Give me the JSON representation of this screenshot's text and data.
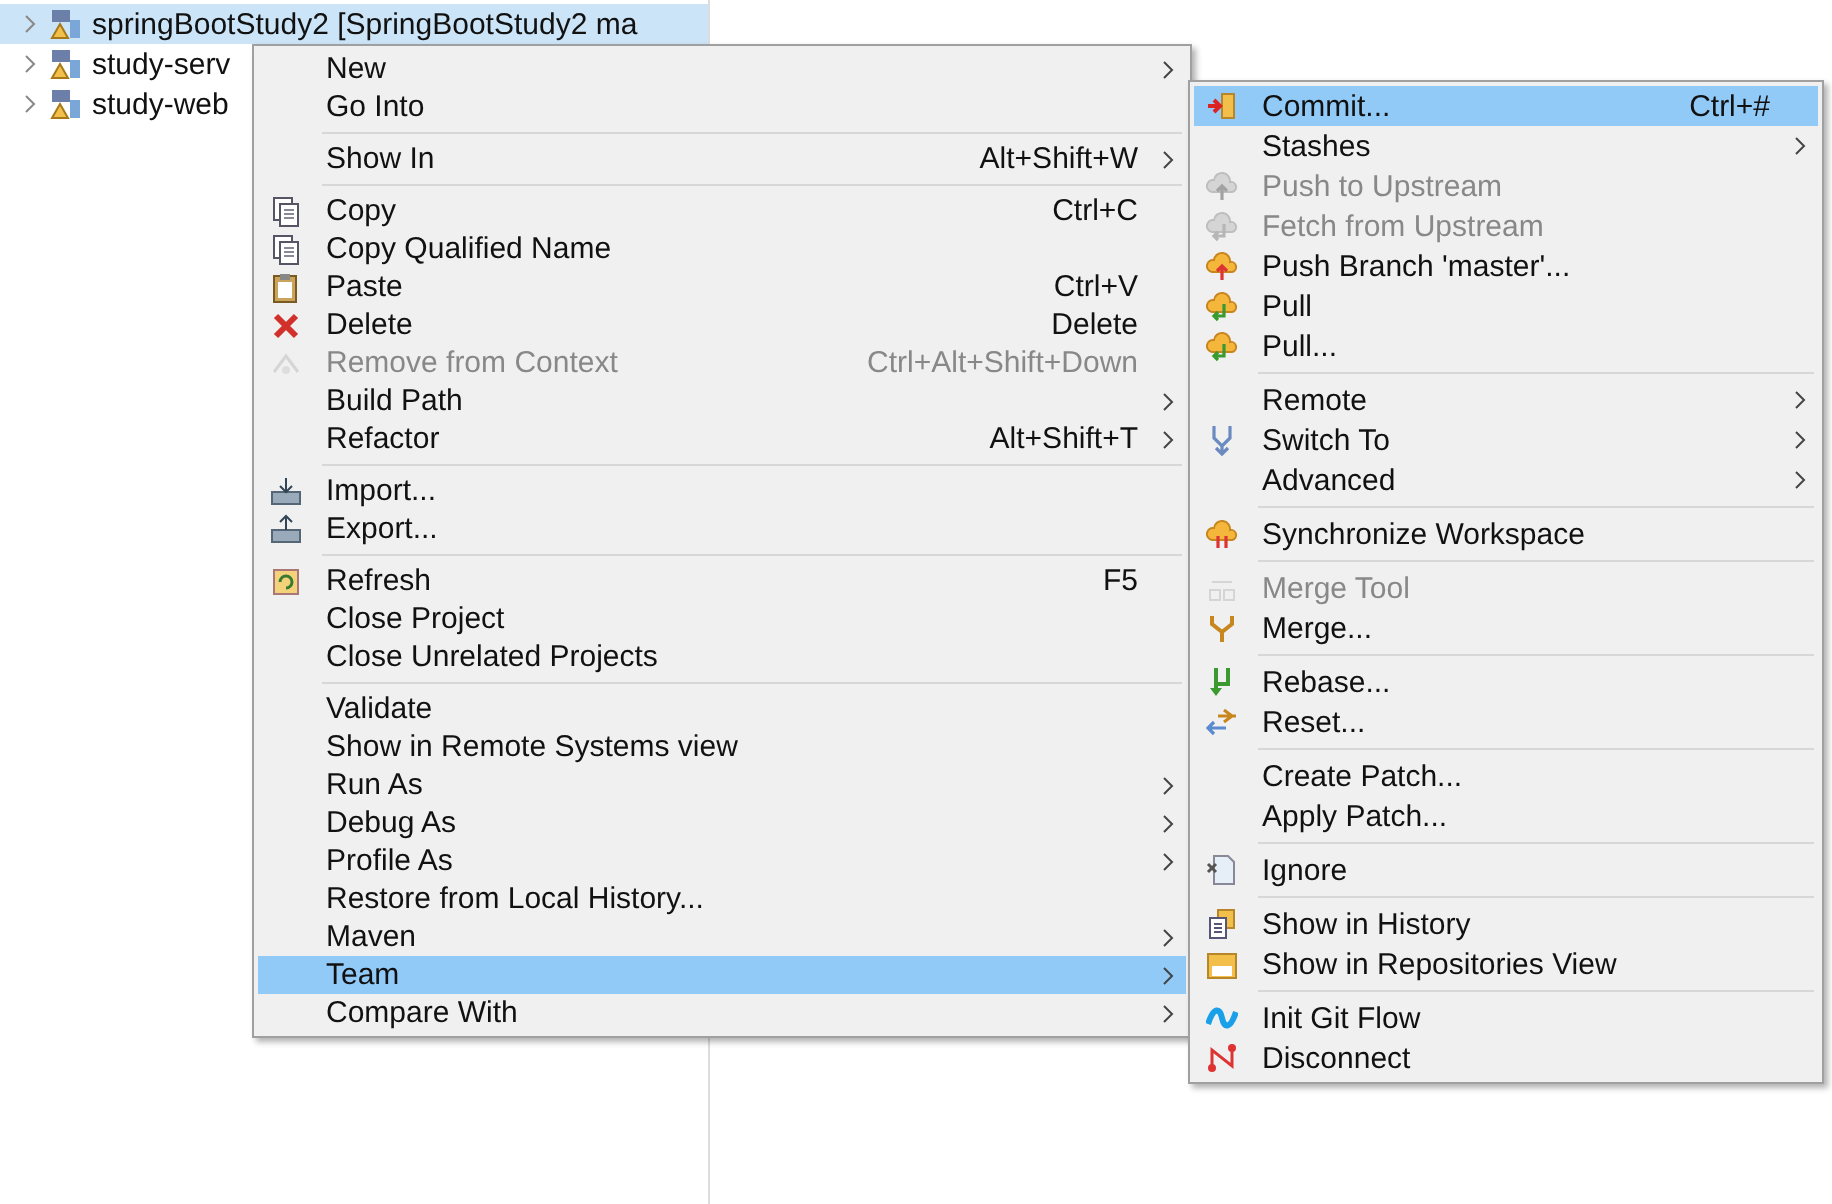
{
  "tree": {
    "items": [
      {
        "label": "springBootStudy2 [SpringBootStudy2 ma",
        "selected": true,
        "expanded": false
      },
      {
        "label": "study-serv",
        "selected": false,
        "expanded": false
      },
      {
        "label": "study-web",
        "selected": false,
        "expanded": false
      }
    ]
  },
  "context_menu": {
    "items": [
      {
        "kind": "item",
        "label": "New",
        "submenu": true,
        "selected": false,
        "disabled": false
      },
      {
        "kind": "item",
        "label": "Go Into",
        "selected": false,
        "disabled": false
      },
      {
        "kind": "separator"
      },
      {
        "kind": "item",
        "label": "Show In",
        "shortcut": "Alt+Shift+W",
        "submenu": true,
        "selected": false,
        "disabled": false
      },
      {
        "kind": "separator"
      },
      {
        "kind": "item",
        "label": "Copy",
        "shortcut": "Ctrl+C",
        "selected": false,
        "disabled": false
      },
      {
        "kind": "item",
        "label": "Copy Qualified Name",
        "selected": false,
        "disabled": false
      },
      {
        "kind": "item",
        "label": "Paste",
        "shortcut": "Ctrl+V",
        "selected": false,
        "disabled": false
      },
      {
        "kind": "item",
        "label": "Delete",
        "shortcut": "Delete",
        "selected": false,
        "disabled": false
      },
      {
        "kind": "item",
        "label": "Remove from Context",
        "shortcut": "Ctrl+Alt+Shift+Down",
        "selected": false,
        "disabled": true
      },
      {
        "kind": "item",
        "label": "Build Path",
        "submenu": true,
        "selected": false,
        "disabled": false
      },
      {
        "kind": "item",
        "label": "Refactor",
        "shortcut": "Alt+Shift+T",
        "submenu": true,
        "selected": false,
        "disabled": false
      },
      {
        "kind": "separator"
      },
      {
        "kind": "item",
        "label": "Import...",
        "selected": false,
        "disabled": false
      },
      {
        "kind": "item",
        "label": "Export...",
        "selected": false,
        "disabled": false
      },
      {
        "kind": "separator"
      },
      {
        "kind": "item",
        "label": "Refresh",
        "shortcut": "F5",
        "selected": false,
        "disabled": false
      },
      {
        "kind": "item",
        "label": "Close Project",
        "selected": false,
        "disabled": false
      },
      {
        "kind": "item",
        "label": "Close Unrelated Projects",
        "selected": false,
        "disabled": false
      },
      {
        "kind": "separator"
      },
      {
        "kind": "item",
        "label": "Validate",
        "selected": false,
        "disabled": false
      },
      {
        "kind": "item",
        "label": "Show in Remote Systems view",
        "selected": false,
        "disabled": false
      },
      {
        "kind": "item",
        "label": "Run As",
        "submenu": true,
        "selected": false,
        "disabled": false
      },
      {
        "kind": "item",
        "label": "Debug As",
        "submenu": true,
        "selected": false,
        "disabled": false
      },
      {
        "kind": "item",
        "label": "Profile As",
        "submenu": true,
        "selected": false,
        "disabled": false
      },
      {
        "kind": "item",
        "label": "Restore from Local History...",
        "selected": false,
        "disabled": false
      },
      {
        "kind": "item",
        "label": "Maven",
        "submenu": true,
        "selected": false,
        "disabled": false
      },
      {
        "kind": "item",
        "label": "Team",
        "submenu": true,
        "selected": true,
        "disabled": false
      },
      {
        "kind": "item",
        "label": "Compare With",
        "submenu": true,
        "selected": false,
        "disabled": false
      }
    ]
  },
  "team_menu": {
    "items": [
      {
        "kind": "item",
        "label": "Commit...",
        "shortcut": "Ctrl+#",
        "selected": true,
        "disabled": false
      },
      {
        "kind": "item",
        "label": "Stashes",
        "submenu": true,
        "selected": false,
        "disabled": false
      },
      {
        "kind": "item",
        "label": "Push to Upstream",
        "selected": false,
        "disabled": true
      },
      {
        "kind": "item",
        "label": "Fetch from Upstream",
        "selected": false,
        "disabled": true
      },
      {
        "kind": "item",
        "label": "Push Branch 'master'...",
        "selected": false,
        "disabled": false
      },
      {
        "kind": "item",
        "label": "Pull",
        "selected": false,
        "disabled": false
      },
      {
        "kind": "item",
        "label": "Pull...",
        "selected": false,
        "disabled": false
      },
      {
        "kind": "separator"
      },
      {
        "kind": "item",
        "label": "Remote",
        "submenu": true,
        "selected": false,
        "disabled": false
      },
      {
        "kind": "item",
        "label": "Switch To",
        "submenu": true,
        "selected": false,
        "disabled": false
      },
      {
        "kind": "item",
        "label": "Advanced",
        "submenu": true,
        "selected": false,
        "disabled": false
      },
      {
        "kind": "separator"
      },
      {
        "kind": "item",
        "label": "Synchronize Workspace",
        "selected": false,
        "disabled": false
      },
      {
        "kind": "separator"
      },
      {
        "kind": "item",
        "label": "Merge Tool",
        "selected": false,
        "disabled": true
      },
      {
        "kind": "item",
        "label": "Merge...",
        "selected": false,
        "disabled": false
      },
      {
        "kind": "separator"
      },
      {
        "kind": "item",
        "label": "Rebase...",
        "selected": false,
        "disabled": false
      },
      {
        "kind": "item",
        "label": "Reset...",
        "selected": false,
        "disabled": false
      },
      {
        "kind": "separator"
      },
      {
        "kind": "item",
        "label": "Create Patch...",
        "selected": false,
        "disabled": false
      },
      {
        "kind": "item",
        "label": "Apply Patch...",
        "selected": false,
        "disabled": false
      },
      {
        "kind": "separator"
      },
      {
        "kind": "item",
        "label": "Ignore",
        "selected": false,
        "disabled": false
      },
      {
        "kind": "separator"
      },
      {
        "kind": "item",
        "label": "Show in History",
        "selected": false,
        "disabled": false
      },
      {
        "kind": "item",
        "label": "Show in Repositories View",
        "selected": false,
        "disabled": false
      },
      {
        "kind": "separator"
      },
      {
        "kind": "item",
        "label": "Init Git Flow",
        "selected": false,
        "disabled": false
      },
      {
        "kind": "item",
        "label": "Disconnect",
        "selected": false,
        "disabled": false
      }
    ]
  }
}
